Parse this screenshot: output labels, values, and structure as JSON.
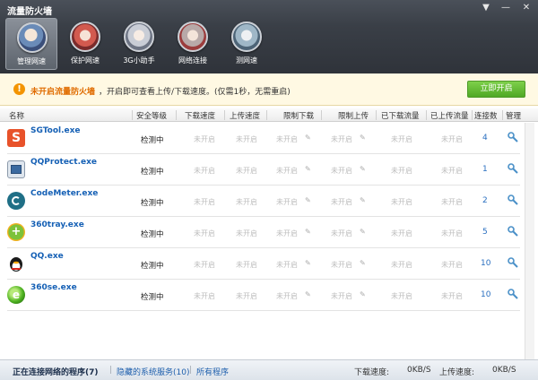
{
  "window": {
    "title": "流量防火墙"
  },
  "toolbar": [
    {
      "label": "管理网速",
      "active": true
    },
    {
      "label": "保护网速",
      "active": false
    },
    {
      "label": "3G小助手",
      "active": false
    },
    {
      "label": "网络连接",
      "active": false
    },
    {
      "label": "测网速",
      "active": false
    }
  ],
  "notice": {
    "highlight": "未开启流量防火墙",
    "text": "，开启即可查看上传/下载速度。(仅需1秒，无需重启)",
    "button": "立即开启"
  },
  "columns": [
    "名称",
    "安全等级",
    "下载速度",
    "上传速度",
    "限制下载",
    "限制上传",
    "已下载流量",
    "已上传流量",
    "连接数",
    "管理"
  ],
  "rows": [
    {
      "name": "SGTool.exe",
      "icon": "sgtool-icon",
      "level": "检测中",
      "dl": "未开启",
      "ul": "未开启",
      "limit_dl": "未开启",
      "limit_ul": "未开启",
      "downloaded": "未开启",
      "uploaded": "未开启",
      "connections": "4"
    },
    {
      "name": "QQProtect.exe",
      "icon": "qqprotect-icon",
      "level": "检测中",
      "dl": "未开启",
      "ul": "未开启",
      "limit_dl": "未开启",
      "limit_ul": "未开启",
      "downloaded": "未开启",
      "uploaded": "未开启",
      "connections": "1"
    },
    {
      "name": "CodeMeter.exe",
      "icon": "codemeter-icon",
      "level": "检测中",
      "dl": "未开启",
      "ul": "未开启",
      "limit_dl": "未开启",
      "limit_ul": "未开启",
      "downloaded": "未开启",
      "uploaded": "未开启",
      "connections": "2"
    },
    {
      "name": "360tray.exe",
      "icon": "360tray-icon",
      "level": "检测中",
      "dl": "未开启",
      "ul": "未开启",
      "limit_dl": "未开启",
      "limit_ul": "未开启",
      "downloaded": "未开启",
      "uploaded": "未开启",
      "connections": "5"
    },
    {
      "name": "QQ.exe",
      "icon": "qq-penguin-icon",
      "level": "检测中",
      "dl": "未开启",
      "ul": "未开启",
      "limit_dl": "未开启",
      "limit_ul": "未开启",
      "downloaded": "未开启",
      "uploaded": "未开启",
      "connections": "10"
    },
    {
      "name": "360se.exe",
      "icon": "360se-icon",
      "level": "检测中",
      "dl": "未开启",
      "ul": "未开启",
      "limit_dl": "未开启",
      "limit_ul": "未开启",
      "downloaded": "未开启",
      "uploaded": "未开启",
      "connections": "10"
    }
  ],
  "status": {
    "active_tab": "正在连接网络的程序(7)",
    "hidden_services": "隐藏的系统服务(10)",
    "all_programs": "所有程序",
    "dl_label": "下载速度:",
    "dl_value": "0KB/S",
    "ul_label": "上传速度:",
    "ul_value": "0KB/S"
  },
  "colors": {
    "accent_green": "#5cb531",
    "link_blue": "#1560b5",
    "warning_orange": "#e06c00"
  }
}
